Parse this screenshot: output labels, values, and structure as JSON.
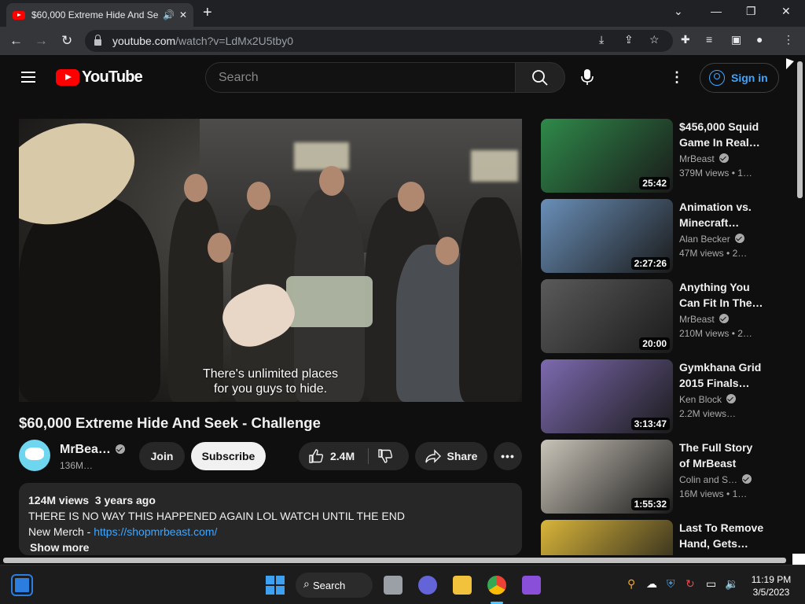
{
  "browser": {
    "tab_title": "$60,000 Extreme Hide And Se",
    "url_host": "youtube.com",
    "url_path": "/watch?v=LdMx2U5tby0"
  },
  "youtube": {
    "logo": "YouTube",
    "search_placeholder": "Search",
    "signin_label": "Sign in"
  },
  "video": {
    "caption_line1": "There's unlimited places",
    "caption_line2": "for you guys to hide.",
    "title": "$60,000 Extreme Hide And Seek - Challenge",
    "channel": "MrBea…",
    "subscribers": "136M…",
    "join_label": "Join",
    "subscribe_label": "Subscribe",
    "likes": "2.4M",
    "share_label": "Share",
    "description": {
      "views": "124M views",
      "age": "3 years ago",
      "line1": "THERE IS NO WAY THIS HAPPENED AGAIN LOL WATCH UNTIL THE END",
      "merch_label": "New Merch - ",
      "merch_link": "https://shopmrbeast.com/",
      "show_more": "Show more"
    }
  },
  "recommendations": [
    {
      "title": "$456,000 Squid Game In Real…",
      "channel": "MrBeast",
      "views": "379M views",
      "age": "• 1…",
      "duration": "25:42",
      "thumb_color": "#2f8a4a"
    },
    {
      "title": "Animation vs. Minecraft…",
      "channel": "Alan Becker",
      "views": "47M views",
      "age": "• 2…",
      "duration": "2:27:26",
      "thumb_color": "#6a8fb8"
    },
    {
      "title": "Anything You Can Fit In The…",
      "channel": "MrBeast",
      "views": "210M views",
      "age": "• 2…",
      "duration": "20:00",
      "thumb_color": "#5a5a5a"
    },
    {
      "title": "Gymkhana Grid 2015 Finals…",
      "channel": "Ken Block",
      "views": "2.2M views…",
      "age": "",
      "duration": "3:13:47",
      "thumb_color": "#7d6ab0"
    },
    {
      "title": "The Full Story of MrBeast",
      "channel": "Colin and S…",
      "views": "16M views",
      "age": "• 1…",
      "duration": "1:55:32",
      "thumb_color": "#c9c4b8"
    },
    {
      "title": "Last To Remove Hand, Gets…",
      "channel": "",
      "views": "",
      "age": "",
      "duration": "",
      "thumb_color": "#d9b53a"
    }
  ],
  "taskbar": {
    "search_label": "Search",
    "time": "11:19 PM",
    "date": "3/5/2023"
  }
}
